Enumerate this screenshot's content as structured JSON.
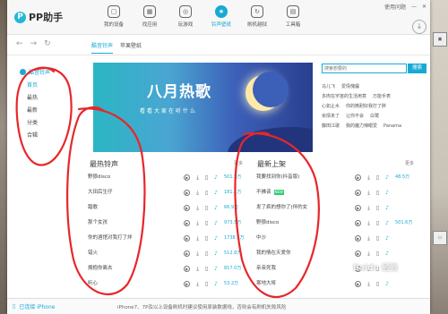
{
  "window": {
    "title": "PP助手"
  },
  "topbar": {
    "logo_text": "PP助手",
    "nav": [
      {
        "label": "我的设备",
        "icon": "device-icon",
        "glyph": "▢"
      },
      {
        "label": "找应用",
        "icon": "apps-icon",
        "glyph": "▦"
      },
      {
        "label": "玩游戏",
        "icon": "gamepad-icon",
        "glyph": "◎"
      },
      {
        "label": "铃声壁纸",
        "icon": "ringtone-icon",
        "glyph": "★"
      },
      {
        "label": "刷机越狱",
        "icon": "refresh-icon",
        "glyph": "↻"
      },
      {
        "label": "工具箱",
        "icon": "toolbox-icon",
        "glyph": "▤"
      }
    ],
    "feedback": "使用问题",
    "min_glyph": "—",
    "close_glyph": "✕"
  },
  "subbar": {
    "back_glyph": "←",
    "forward_glyph": "→",
    "refresh_glyph": "↻",
    "tabs": [
      "酷音铃声",
      "苹果壁纸"
    ]
  },
  "sidebar": {
    "header": "酷音铃声",
    "items": [
      "首页",
      "最热",
      "最新",
      "分类",
      "合辑"
    ]
  },
  "banner": {
    "title": "八月热歌",
    "subtitle": "看看大家在听什么"
  },
  "search": {
    "placeholder": "搜索想要的",
    "button": "搜索"
  },
  "hot_tags": [
    [
      "马儿飞",
      "爱情傀儡"
    ],
    [
      "多肉在宇宙的生活用意",
      "万能手表"
    ],
    [
      "心如止水",
      "你的微耐好我打了胖"
    ],
    [
      "余情未了",
      "让你不会",
      "白鹭"
    ],
    [
      "藤田江歌",
      "我的魔力辣眼爱",
      "Panama"
    ]
  ],
  "hottest": {
    "title": "最热铃声",
    "more": "更多",
    "songs": [
      {
        "name": "野狼disco",
        "count": "501.5万"
      },
      {
        "name": "大田后生仔",
        "count": "181.1万"
      },
      {
        "name": "踏歌",
        "count": "66.9万"
      },
      {
        "name": "那个女孩",
        "count": "973.5万"
      },
      {
        "name": "你的酒馆对我打了烊",
        "count": "1738.5万"
      },
      {
        "name": "错火",
        "count": "512.8万"
      },
      {
        "name": "拥抱你离去",
        "count": "817.0万"
      },
      {
        "name": "听心",
        "count": "53.2万"
      }
    ]
  },
  "newest": {
    "title": "最新上架",
    "more": "更多",
    "songs": [
      {
        "name": "我要找到你(抖音版)",
        "count": "48.5万",
        "new": false
      },
      {
        "name": "不拂该",
        "count": "",
        "new": true
      },
      {
        "name": "发了疯的想你了(伴的女",
        "count": "",
        "new": false
      },
      {
        "name": "野狼disco",
        "count": "501.6万",
        "new": false
      },
      {
        "name": "中沙",
        "count": "",
        "new": false
      },
      {
        "name": "我的情在天爱你",
        "count": "",
        "new": false
      },
      {
        "name": "亲亲死我",
        "count": "",
        "new": false
      },
      {
        "name": "寒地大将",
        "count": "",
        "new": false
      }
    ]
  },
  "bottombar": {
    "device": "已连接 iPhone",
    "notice": "iPhone7、7P及以上设备刷机时建议使用原装数据线，否则会有刷机失败风险"
  },
  "watermark": "Baidu 经验",
  "colors": {
    "accent": "#19a9d5",
    "annotation": "#e8262a"
  }
}
